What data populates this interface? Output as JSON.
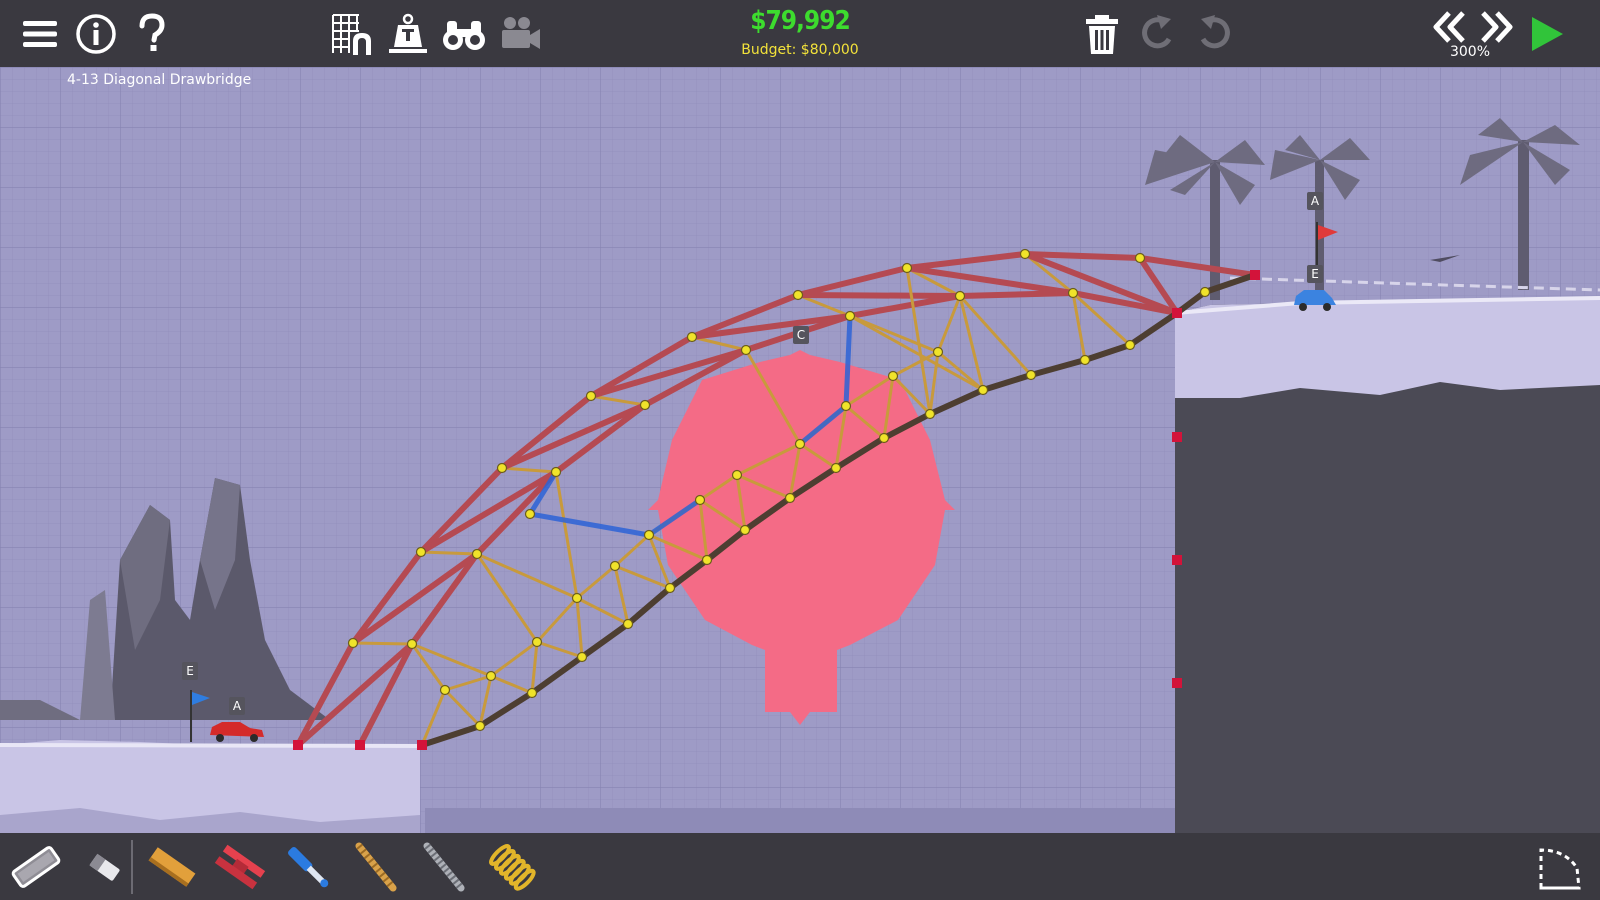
{
  "toolbar": {
    "menu_icon": "hamburger-icon",
    "info_icon": "info-icon",
    "help_icon": "question-icon",
    "grid_icon": "grid-magnet-icon",
    "weight_icon": "weight-icon",
    "binoculars_icon": "binoculars-icon",
    "camera_icon": "movie-camera-icon",
    "trash_icon": "trash-icon",
    "redo_icon": "redo-icon",
    "undo_icon": "undo-icon",
    "rewind_icon": "double-chevron-left-icon",
    "fastforward_icon": "double-chevron-right-icon",
    "play_icon": "play-icon"
  },
  "level": {
    "name": "4-13 Diagonal Drawbridge"
  },
  "money": {
    "cost": "$79,992",
    "budget": "Budget: $80,000"
  },
  "simulation": {
    "speed": "300%"
  },
  "markers": {
    "left_flag": "E",
    "left_car": "A",
    "center": "C",
    "right_flag": "A",
    "right_car": "E"
  },
  "materials": [
    {
      "name": "road",
      "icon": "road-material-icon"
    },
    {
      "name": "eraser",
      "icon": "eraser-icon"
    },
    {
      "name": "wood",
      "icon": "wood-material-icon"
    },
    {
      "name": "steel",
      "icon": "steel-material-icon"
    },
    {
      "name": "hydraulics",
      "icon": "hydraulic-piston-icon"
    },
    {
      "name": "rope",
      "icon": "rope-material-icon"
    },
    {
      "name": "cable",
      "icon": "cable-material-icon"
    },
    {
      "name": "spring",
      "icon": "spring-material-icon"
    }
  ],
  "corner_tool": {
    "icon": "split-joint-icon"
  },
  "colors": {
    "toolbar_bg": "#3a3940",
    "background": "#9e9bc6",
    "cost_green": "#3ddc2e",
    "budget_yellow": "#f2e23a",
    "steel_red": "#b54a52",
    "wood_tan": "#c89a3c",
    "road_dark": "#4d3e31",
    "joint_yellow": "#f0e32a",
    "anchor_red": "#d3133a",
    "hydraulic_blue": "#2b63d6",
    "boat_zone_pink": "#f46b86",
    "ground_light": "#c9c5e6",
    "cliff_dark": "#4b4a55",
    "play_green": "#31c43a"
  }
}
